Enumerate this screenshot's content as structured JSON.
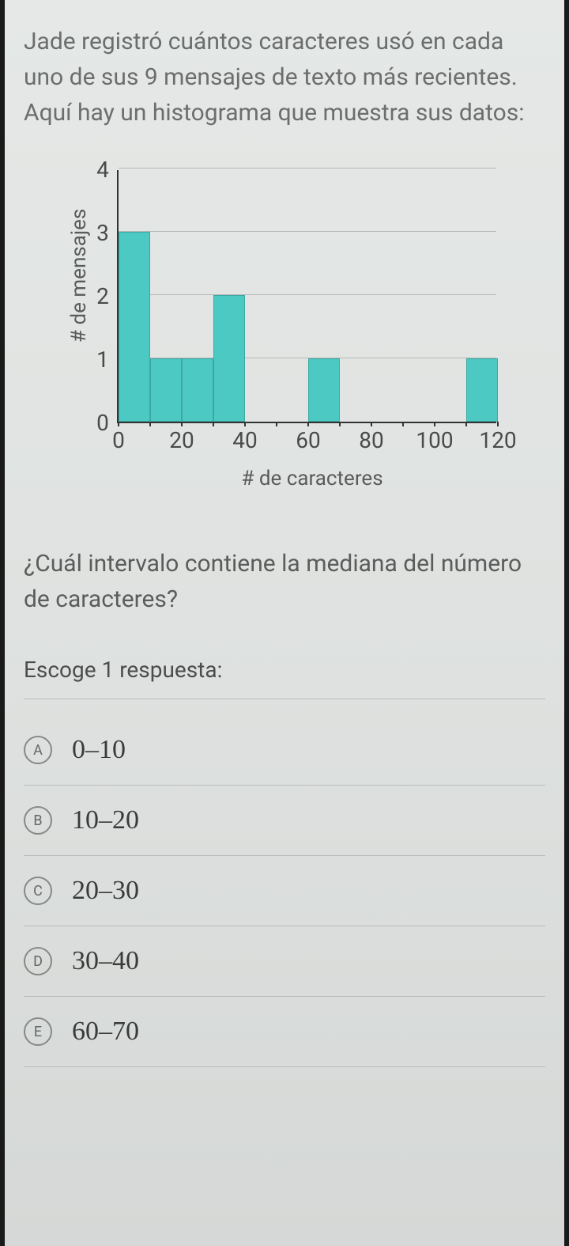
{
  "problem": "Jade registró cuántos caracteres usó en cada uno de sus 9 mensajes de texto más recientes. Aquí hay un histograma que muestra sus datos:",
  "question": "¿Cuál intervalo contiene la mediana del número de caracteres?",
  "instruction": "Escoge 1 respuesta:",
  "answers": [
    {
      "letter": "A",
      "text": "0–10"
    },
    {
      "letter": "B",
      "text": "10–20"
    },
    {
      "letter": "C",
      "text": "20–30"
    },
    {
      "letter": "D",
      "text": "30–40"
    },
    {
      "letter": "E",
      "text": "60–70"
    }
  ],
  "chart_data": {
    "type": "bar",
    "title": "",
    "xlabel": "# de caracteres",
    "ylabel": "# de mensajes",
    "xlim": [
      0,
      120
    ],
    "ylim": [
      0,
      4
    ],
    "x_ticks": [
      0,
      20,
      40,
      60,
      80,
      100,
      120
    ],
    "y_ticks": [
      0,
      1,
      2,
      3,
      4
    ],
    "bins": [
      {
        "start": 0,
        "end": 10,
        "value": 3
      },
      {
        "start": 10,
        "end": 20,
        "value": 1
      },
      {
        "start": 20,
        "end": 30,
        "value": 1
      },
      {
        "start": 30,
        "end": 40,
        "value": 2
      },
      {
        "start": 60,
        "end": 70,
        "value": 1
      },
      {
        "start": 110,
        "end": 120,
        "value": 1
      }
    ]
  }
}
